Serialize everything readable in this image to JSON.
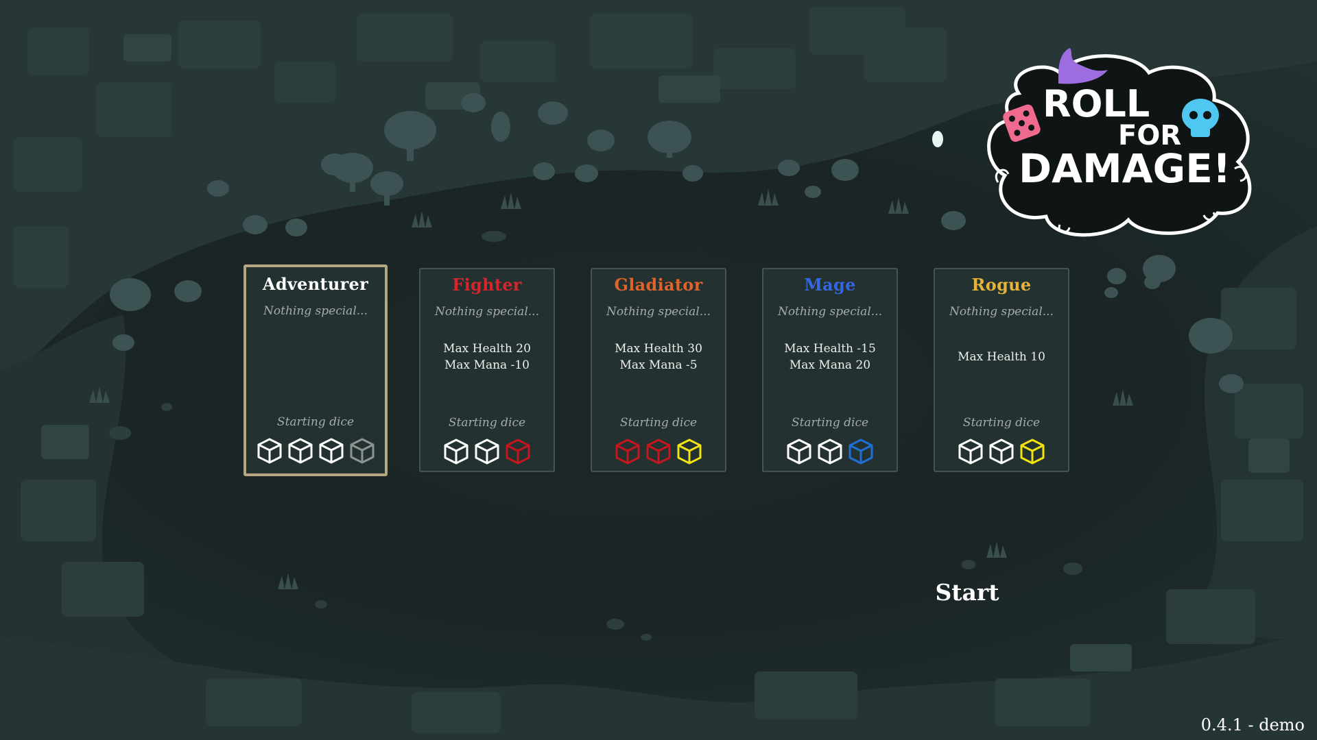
{
  "logo": {
    "line1": "ROLL",
    "line2": "FOR",
    "line3": "DAMAGE!"
  },
  "classes": [
    {
      "name": "Adventurer",
      "name_color": "#ffffff",
      "description": "Nothing special...",
      "stats": [],
      "starting_dice_label": "Starting dice",
      "starting_dice": [
        "white",
        "white",
        "white",
        "gray"
      ],
      "selected": true
    },
    {
      "name": "Fighter",
      "name_color": "#d6262b",
      "description": "Nothing special...",
      "stats": [
        "Max Health 20",
        "Max Mana -10"
      ],
      "starting_dice_label": "Starting dice",
      "starting_dice": [
        "white",
        "white",
        "red"
      ],
      "selected": false
    },
    {
      "name": "Gladiator",
      "name_color": "#e0632c",
      "description": "Nothing special...",
      "stats": [
        "Max Health 30",
        "Max Mana -5"
      ],
      "starting_dice_label": "Starting dice",
      "starting_dice": [
        "red",
        "red",
        "yellow"
      ],
      "selected": false
    },
    {
      "name": "Mage",
      "name_color": "#3468e0",
      "description": "Nothing special...",
      "stats": [
        "Max Health -15",
        "Max Mana 20"
      ],
      "starting_dice_label": "Starting dice",
      "starting_dice": [
        "white",
        "white",
        "blue"
      ],
      "selected": false
    },
    {
      "name": "Rogue",
      "name_color": "#e6b33a",
      "description": "Nothing special...",
      "stats": [
        "Max Health 10"
      ],
      "starting_dice_label": "Starting dice",
      "starting_dice": [
        "white",
        "white",
        "yellow"
      ],
      "selected": false
    }
  ],
  "dice_colors": {
    "white": "#ffffff",
    "gray": "#8f9493",
    "red": "#c4161c",
    "yellow": "#f2e313",
    "blue": "#1f6fd6"
  },
  "start_label": "Start",
  "version": "0.4.1 - demo"
}
